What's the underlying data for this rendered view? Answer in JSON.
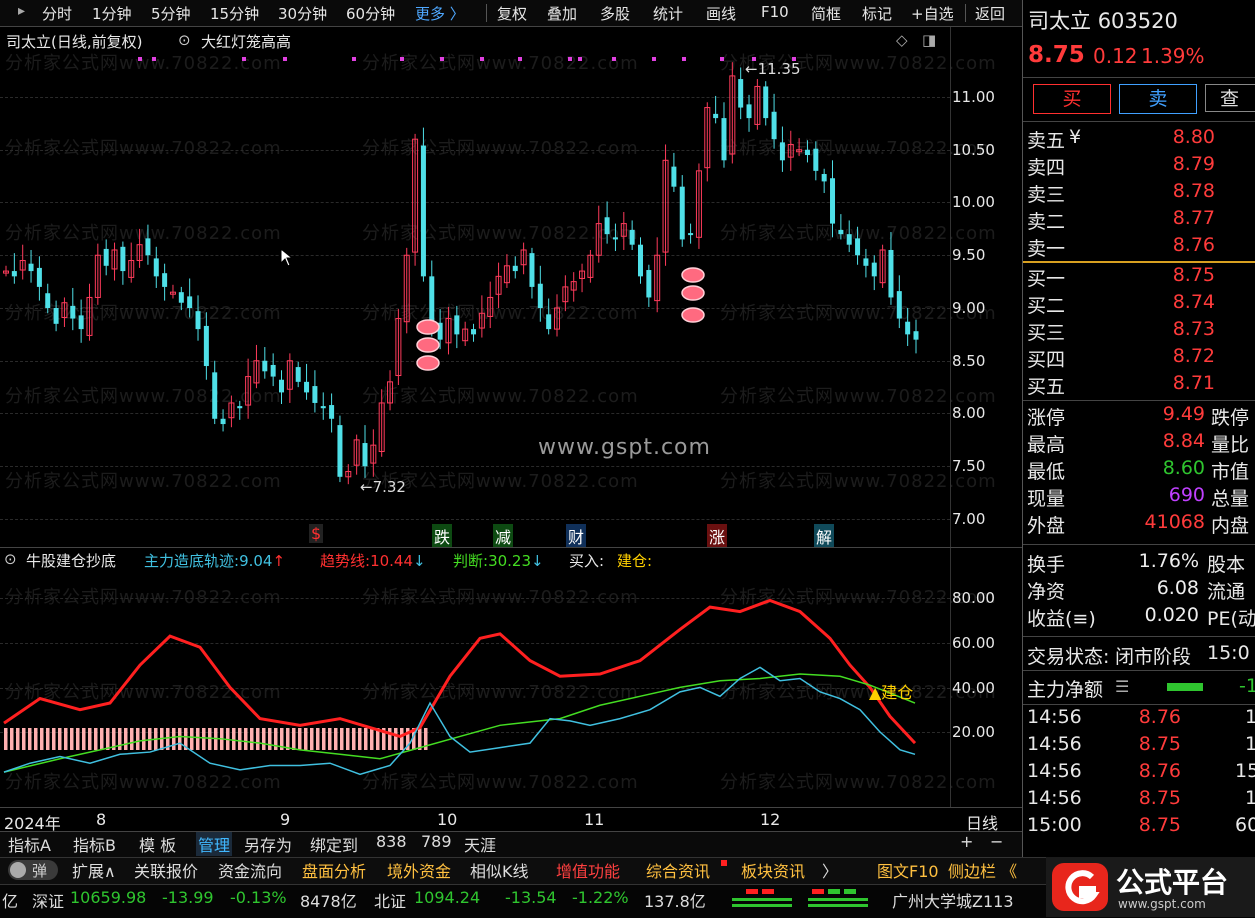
{
  "toolbar": {
    "items": [
      "分时",
      "1分钟",
      "5分钟",
      "15分钟",
      "30分钟",
      "60分钟",
      "更多 〉",
      "复权",
      "叠加",
      "多股",
      "统计",
      "画线",
      "F10",
      "简框",
      "标记",
      "+自选",
      "返回"
    ]
  },
  "chart": {
    "title": "司太立(日线,前复权)",
    "indicator_name": "大红灯笼高高",
    "y_labels": [
      "11.00",
      "10.50",
      "10.00",
      "9.50",
      "9.00",
      "8.50",
      "8.00",
      "7.50",
      "7.00"
    ],
    "high_marker": "11.35",
    "low_marker": "7.32",
    "signal_tags": [
      {
        "text": "$",
        "color": "#ff3030"
      },
      {
        "text": "跌",
        "color": "#20c020"
      },
      {
        "text": "减",
        "color": "#20c020"
      },
      {
        "text": "财",
        "color": "#40a0ff"
      },
      {
        "text": "涨",
        "color": "#ff3030"
      },
      {
        "text": "解",
        "color": "#40c8ff"
      }
    ],
    "center_watermark": "www.gspt.com",
    "watermark": "分析家公式网www.70822.com"
  },
  "subchart": {
    "name": "牛股建仓抄底",
    "l1_label": "主力造底轨迹:",
    "l1_value": "9.04",
    "l1_arrow": "↑",
    "l2_label": "趋势线:",
    "l2_value": "10.44",
    "l2_arrow": "↓",
    "l3_label": "判断:",
    "l3_value": "30.23",
    "l3_arrow": "↓",
    "l4_label": "买入:",
    "l5_label": "建仓:",
    "y_labels": [
      "80.00",
      "60.00",
      "40.00",
      "20.00"
    ],
    "build_label": "▲建仓",
    "colors": {
      "trend": "#ff2020",
      "judge": "#44dd22",
      "main": "#40c0e0",
      "bars": "#ffb0b0",
      "build": "#ffd000"
    }
  },
  "x_axis": {
    "labels": [
      "2024年",
      "8",
      "9",
      "10",
      "11",
      "12"
    ],
    "period": "日线"
  },
  "bottom_tabs": [
    "指标A",
    "指标B",
    "模 板",
    "管理",
    "另存为",
    "绑定到",
    "838",
    "789",
    "天涯"
  ],
  "bottom_right_controls": [
    "+",
    "−"
  ],
  "function_tabs": [
    {
      "text": "扩展∧",
      "color": "#dddddd"
    },
    {
      "text": "关联报价",
      "color": "#dddddd"
    },
    {
      "text": "资金流向",
      "color": "#dddddd"
    },
    {
      "text": "盘面分析",
      "color": "#ffc040"
    },
    {
      "text": "境外资金",
      "color": "#ffc040"
    },
    {
      "text": "相似K线",
      "color": "#dddddd"
    },
    {
      "text": "增值功能",
      "color": "#ff4040"
    },
    {
      "text": "综合资讯",
      "color": "#ffc040"
    },
    {
      "text": "板块资讯",
      "color": "#ffc040"
    },
    {
      "text": "〉",
      "color": "#dddddd"
    },
    {
      "text": "图文F10",
      "color": "#ffc040"
    },
    {
      "text": "侧边栏 《",
      "color": "#ffc040"
    }
  ],
  "toggle_label": "弹",
  "status_bar": {
    "prefix": "亿",
    "sz_label": "深证",
    "sz_value": "10659.98",
    "sz_change": "-13.99",
    "sz_pct": "-0.13%",
    "sz_amount": "8478亿",
    "bj_label": "北证",
    "bj_value": "1094.24",
    "bj_change": "-13.54",
    "bj_pct": "-1.22%",
    "bj_amount": "137.8亿",
    "location": "广州大学城Z113"
  },
  "logo": {
    "text": "公式平台",
    "url": "www.gspt.com"
  },
  "quote": {
    "name": "司太立",
    "code": "603520",
    "price": "8.75",
    "change": "0.12",
    "pct": "1.39%",
    "buy_btn": "买",
    "sell_btn": "卖",
    "query_btn": "查",
    "asks": [
      {
        "label": "卖五",
        "price": "8.80"
      },
      {
        "label": "卖四",
        "price": "8.79"
      },
      {
        "label": "卖三",
        "price": "8.78"
      },
      {
        "label": "卖二",
        "price": "8.77"
      },
      {
        "label": "卖一",
        "price": "8.76"
      }
    ],
    "ask_currency": "¥",
    "bids": [
      {
        "label": "买一",
        "price": "8.75"
      },
      {
        "label": "买二",
        "price": "8.74"
      },
      {
        "label": "买三",
        "price": "8.73"
      },
      {
        "label": "买四",
        "price": "8.72"
      },
      {
        "label": "买五",
        "price": "8.71"
      }
    ],
    "stats": [
      {
        "label": "涨停",
        "value": "9.49",
        "color": "#ff3b3b",
        "label2": "跌停"
      },
      {
        "label": "最高",
        "value": "8.84",
        "color": "#ff3b3b",
        "label2": "量比"
      },
      {
        "label": "最低",
        "value": "8.60",
        "color": "#2fc52f",
        "label2": "市值"
      },
      {
        "label": "现量",
        "value": "690",
        "color": "#c040ff",
        "label2": "总量"
      },
      {
        "label": "外盘",
        "value": "41068",
        "color": "#ff3b3b",
        "label2": "内盘"
      }
    ],
    "stats2": [
      {
        "label": "换手",
        "value": "1.76%",
        "label2": "股本"
      },
      {
        "label": "净资",
        "value": "6.08",
        "label2": "流通"
      },
      {
        "label": "收益(≡)",
        "value": "0.020",
        "label2": "PE(动"
      }
    ],
    "trade_status_label": "交易状态:",
    "trade_status_value": "闭市阶段",
    "trade_status_time": "15:0",
    "net_label": "主力净额",
    "net_value_partial": "-1",
    "ticks": [
      {
        "time": "14:56",
        "price": "8.76",
        "vol": "1",
        "vol_color": "#ffd400"
      },
      {
        "time": "14:56",
        "price": "8.75",
        "vol": "1",
        "vol_color": "#ffd400"
      },
      {
        "time": "14:56",
        "price": "8.76",
        "vol": "15",
        "vol_color": "#ffd400"
      },
      {
        "time": "14:56",
        "price": "8.75",
        "vol": "1",
        "vol_color": "#ffd400"
      },
      {
        "time": "15:00",
        "price": "8.75",
        "vol": "60",
        "vol_color": "#c040ff"
      }
    ]
  }
}
